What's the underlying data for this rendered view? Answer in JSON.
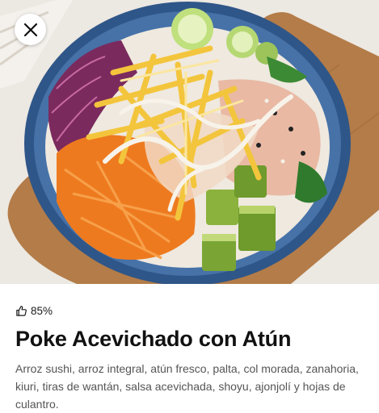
{
  "dish": {
    "rating": "85%",
    "title": "Poke Acevichado con Atún",
    "description": "Arroz sushi, arroz integral, atún fresco, palta, col morada, zanahoria, kiuri, tiras de wantán, salsa acevichada, shoyu, ajonjolí y hojas de culantro."
  },
  "icons": {
    "close": "close-icon",
    "rating": "thumbs-up-icon"
  },
  "colors": {
    "bowl_rim": "#3f6a9e",
    "board": "#b07a45",
    "title": "#111111",
    "description": "#555555"
  }
}
